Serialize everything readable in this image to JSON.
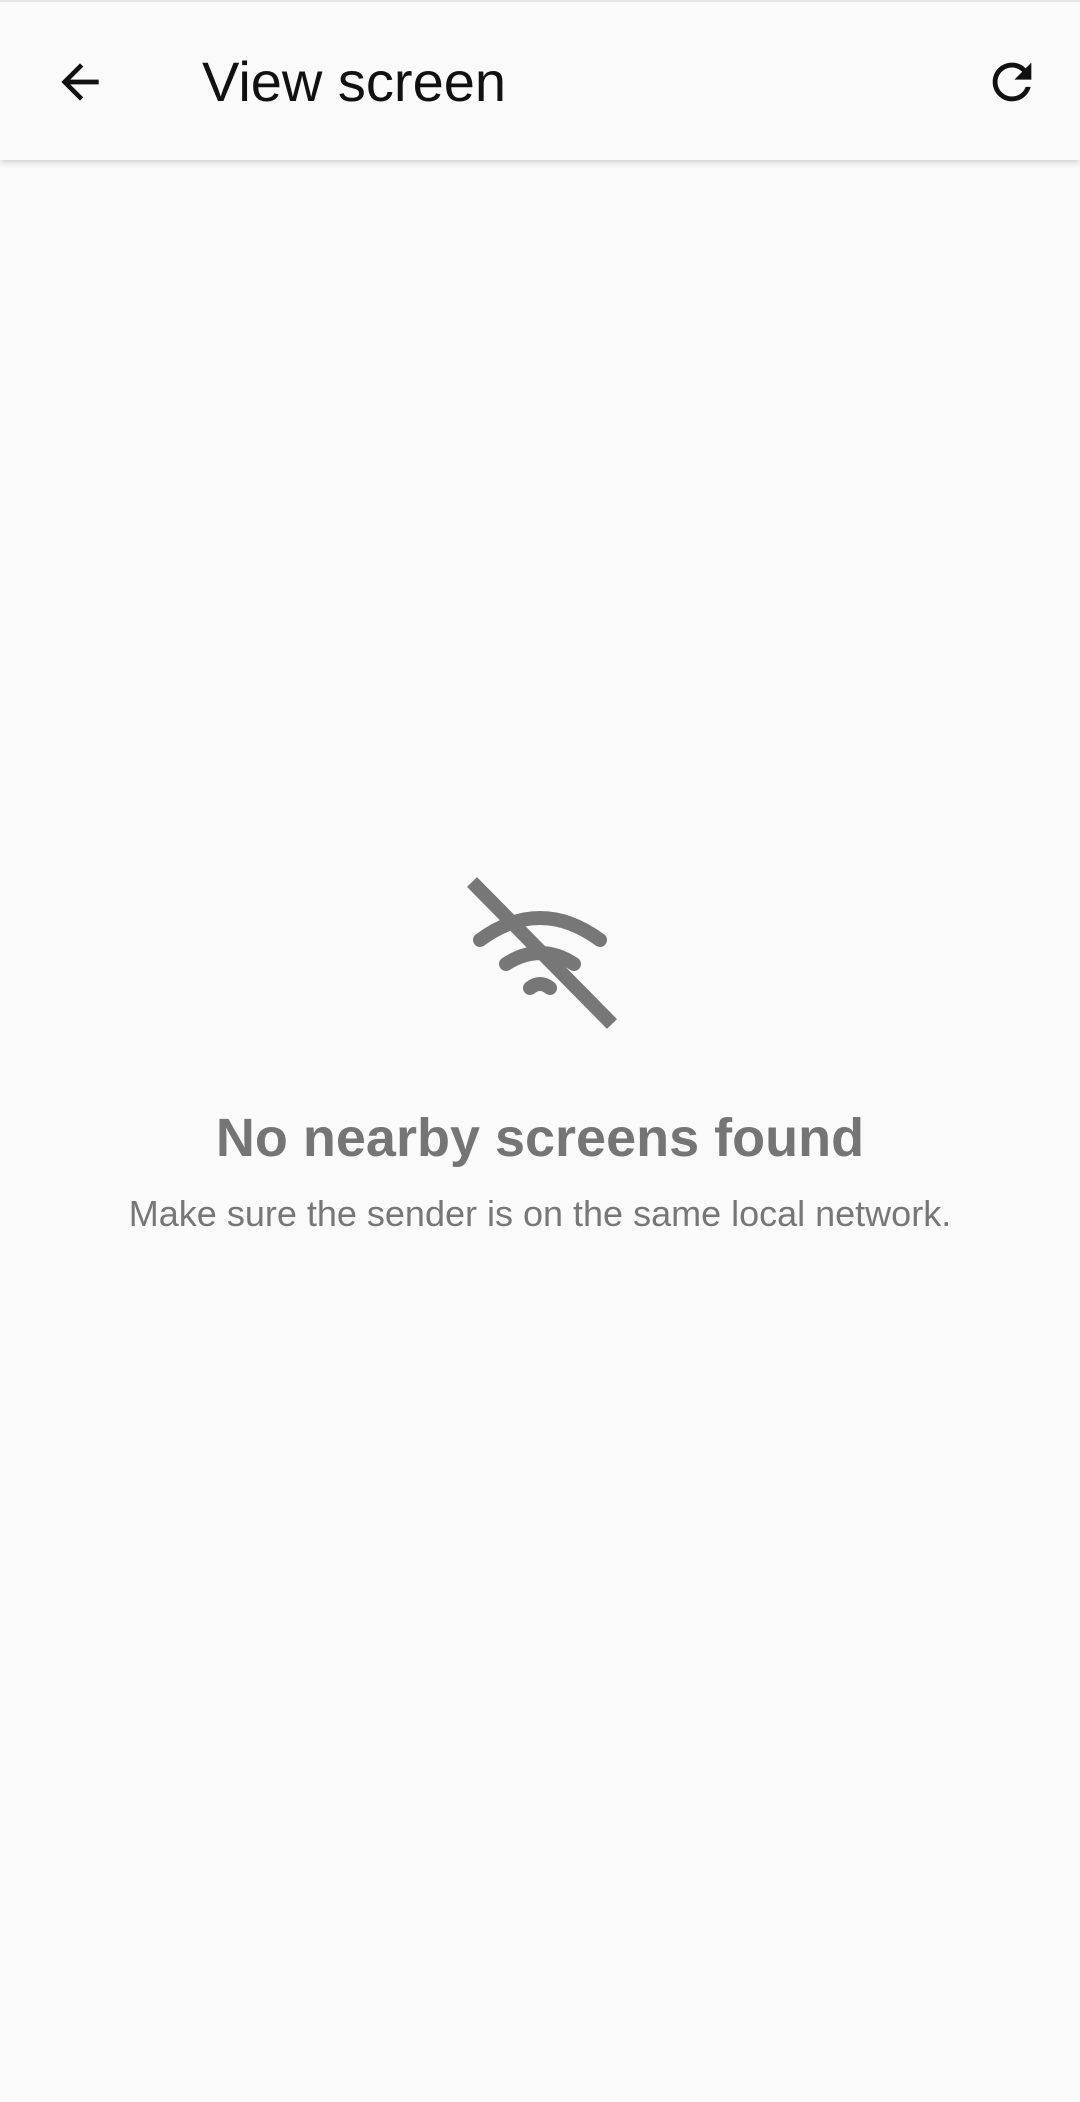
{
  "app_bar": {
    "title": "View screen",
    "back_icon": "arrow-back-icon",
    "refresh_icon": "refresh-icon"
  },
  "empty_state": {
    "icon": "wifi-off-icon",
    "title": "No nearby screens found",
    "subtitle": "Make sure the sender is on the same local network."
  },
  "colors": {
    "background": "#fafafa",
    "icon_gray": "#777777",
    "title_text": "#111111"
  }
}
